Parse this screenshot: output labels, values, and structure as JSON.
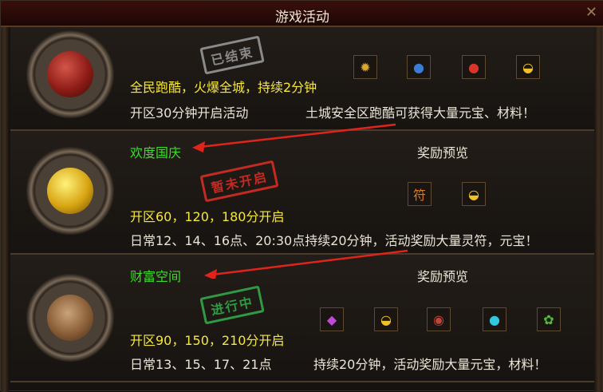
{
  "window": {
    "title": "游戏活动"
  },
  "activities": [
    {
      "name": "全民跑酷，火爆全城，持续2分钟",
      "stamp": "已结束",
      "schedule": "开区30分钟开启活动",
      "description": "土城安全区跑酷可获得大量元宝、材料！",
      "rewards": [
        "medal-icon",
        "blue-orb-icon",
        "red-orb-icon",
        "gold-ingot-icon"
      ]
    },
    {
      "name": "欢度国庆",
      "stamp": "暂未开启",
      "reward_label": "奖励预览",
      "schedule": "开区60，120，180分开启",
      "description": "日常12、14、16点、20:30点持续20分钟，活动奖励大量灵符，元宝！",
      "rewards": [
        "talisman-icon",
        "gold-ingot-icon"
      ]
    },
    {
      "name": "财富空间",
      "stamp": "进行中",
      "reward_label": "奖励预览",
      "schedule": "开区90，150，210分开启",
      "schedule2": "日常13、15、17、21点",
      "description": "持续20分钟，活动奖励大量元宝，材料！",
      "rewards": [
        "purple-gem-icon",
        "gold-ingot-icon",
        "red-stone-icon",
        "cyan-orb-icon",
        "green-herb-icon"
      ]
    }
  ],
  "colors": {
    "title_bar": "#3a0f0b",
    "name_yellow": "#f5e83a",
    "name_green": "#3ddc2b",
    "arrow": "#e0241c"
  }
}
